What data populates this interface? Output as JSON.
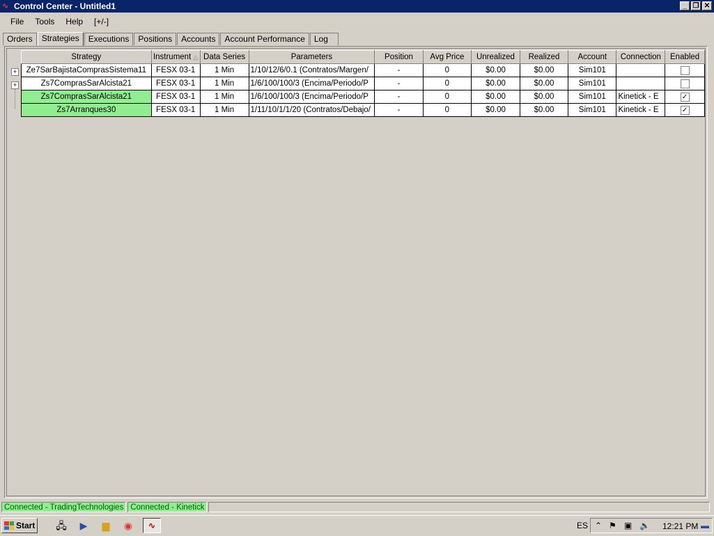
{
  "window": {
    "title": "Control Center - Untitled1"
  },
  "menu": [
    "File",
    "Tools",
    "Help",
    "[+/-]"
  ],
  "tabs": [
    "Orders",
    "Strategies",
    "Executions",
    "Positions",
    "Accounts",
    "Account Performance",
    "Log"
  ],
  "active_tab": "Strategies",
  "table": {
    "columns": [
      "Strategy",
      "Instrument",
      "Data Series",
      "Parameters",
      "Position",
      "Avg Price",
      "Unrealized",
      "Realized",
      "Account",
      "Connection",
      "Enabled"
    ],
    "sorted_column": "Instrument",
    "rows": [
      {
        "strategy": "Ze7SarBajistaComprasSistema11",
        "instrument": "FESX 03-1",
        "data_series": "1 Min",
        "parameters": "1/10/12/6/0.1 (Contratos/Margen/",
        "position": "-",
        "avg_price": "0",
        "unrealized": "$0.00",
        "realized": "$0.00",
        "account": "Sim101",
        "connection": "",
        "enabled": false,
        "highlight": false,
        "expandable": true
      },
      {
        "strategy": "Zs7ComprasSarAlcista21",
        "instrument": "FESX 03-1",
        "data_series": "1 Min",
        "parameters": "1/6/100/100/3 (Encima/Periodo/P",
        "position": "-",
        "avg_price": "0",
        "unrealized": "$0.00",
        "realized": "$0.00",
        "account": "Sim101",
        "connection": "",
        "enabled": false,
        "highlight": false,
        "expandable": true
      },
      {
        "strategy": "Zs7ComprasSarAlcista21",
        "instrument": "FESX 03-1",
        "data_series": "1 Min",
        "parameters": "1/6/100/100/3 (Encima/Periodo/P",
        "position": "-",
        "avg_price": "0",
        "unrealized": "$0.00",
        "realized": "$0.00",
        "account": "Sim101",
        "connection": "Kinetick - E",
        "enabled": true,
        "highlight": true,
        "expandable": false
      },
      {
        "strategy": "Zs7Arranques30",
        "instrument": "FESX 03-1",
        "data_series": "1 Min",
        "parameters": "1/11/10/1/1/20 (Contratos/Debajo/",
        "position": "-",
        "avg_price": "0",
        "unrealized": "$0.00",
        "realized": "$0.00",
        "account": "Sim101",
        "connection": "Kinetick - E",
        "enabled": true,
        "highlight": true,
        "expandable": false
      }
    ]
  },
  "status": [
    "Connected - TradingTechnologies",
    "Connected - Kinetick"
  ],
  "taskbar": {
    "start": "Start",
    "language": "ES",
    "clock": "12:21 PM"
  },
  "colors": {
    "title_bar": "#0a246a",
    "highlight_row": "#90ee90",
    "status_text": "#006000"
  }
}
